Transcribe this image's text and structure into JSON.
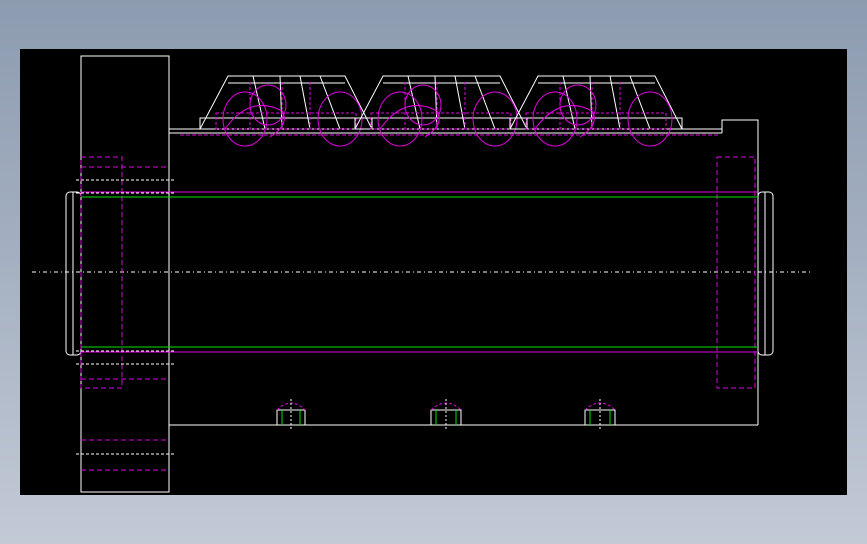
{
  "drawing": {
    "background_color": "#000000",
    "frame_color": "#8d9bb0",
    "outline_color": "#ffffff",
    "hidden_line_color": "#e000e0",
    "bore_line_color": "#00e000",
    "centerline_color": "#ffffff"
  }
}
